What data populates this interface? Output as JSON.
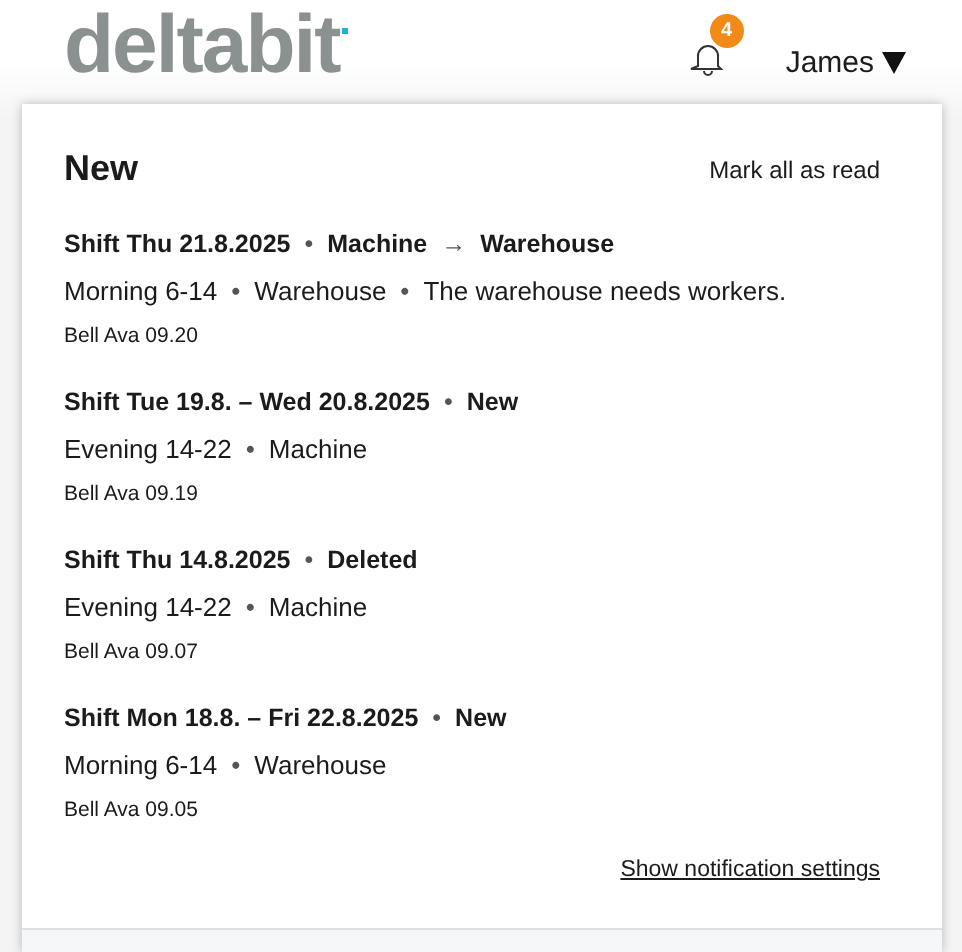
{
  "header": {
    "logo": "deltabit",
    "notification_count": "4",
    "user": "James"
  },
  "panel": {
    "title": "New",
    "mark_all": "Mark all as read",
    "settings_link": "Show notification settings",
    "notifications": [
      {
        "title": [
          {
            "text": "Shift Thu 21.8.2025"
          },
          {
            "text": "Machine",
            "sep": "•"
          },
          {
            "text": "Warehouse",
            "sep": "→"
          }
        ],
        "details": [
          {
            "text": "Morning 6-14"
          },
          {
            "text": "Warehouse",
            "sep": "•"
          },
          {
            "text": "The warehouse needs workers.",
            "sep": "•"
          }
        ],
        "meta": "Bell Ava 09.20"
      },
      {
        "title": [
          {
            "text": "Shift Tue 19.8. – Wed 20.8.2025"
          },
          {
            "text": "New",
            "sep": "•"
          }
        ],
        "details": [
          {
            "text": "Evening 14-22"
          },
          {
            "text": "Machine",
            "sep": "•"
          }
        ],
        "meta": "Bell Ava 09.19"
      },
      {
        "title": [
          {
            "text": "Shift Thu 14.8.2025"
          },
          {
            "text": "Deleted",
            "sep": "•"
          }
        ],
        "details": [
          {
            "text": "Evening 14-22"
          },
          {
            "text": "Machine",
            "sep": "•"
          }
        ],
        "meta": "Bell Ava 09.07"
      },
      {
        "title": [
          {
            "text": "Shift Mon 18.8. – Fri 22.8.2025"
          },
          {
            "text": "New",
            "sep": "•"
          }
        ],
        "details": [
          {
            "text": "Morning 6-14"
          },
          {
            "text": "Warehouse",
            "sep": "•"
          }
        ],
        "meta": "Bell Ava 09.05"
      }
    ]
  }
}
